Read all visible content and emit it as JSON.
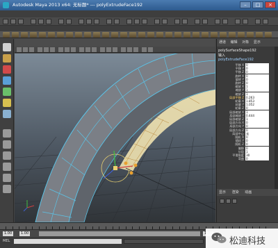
{
  "window": {
    "title": "Autodesk Maya 2013 x64: 无标题* --- polyExtrudeFace192"
  },
  "channel_box": {
    "menu": [
      "通道",
      "编辑",
      "对象",
      "显示"
    ],
    "node_selected": "polySurfaceShape192",
    "inputs_label": "输入",
    "inputs_node": "polyExtrudeFace192",
    "attributes": [
      {
        "label": "平移 X",
        "value": "0"
      },
      {
        "label": "平移 Y",
        "value": "0"
      },
      {
        "label": "平移 Z",
        "value": "0"
      },
      {
        "label": "旋转 X",
        "value": "0"
      },
      {
        "label": "旋转 Y",
        "value": "0"
      },
      {
        "label": "旋转 Z",
        "value": "0"
      },
      {
        "label": "缩放 X",
        "value": "1"
      },
      {
        "label": "缩放 Y",
        "value": "1"
      },
      {
        "label": "缩放 Z",
        "value": "1"
      },
      {
        "label": "局部平移 Z",
        "value": "0.263"
      },
      {
        "label": "轮廓 X",
        "value": "1.853"
      },
      {
        "label": "轮廓 Y",
        "value": "1.052"
      },
      {
        "label": "轮廓 Z",
        "value": "0"
      },
      {
        "label": "局部缩放 X",
        "value": "1"
      },
      {
        "label": "局部缩放 Y",
        "value": "0.444"
      },
      {
        "label": "局部缩放 Z",
        "value": "1"
      },
      {
        "label": "局部方向 X",
        "value": "0"
      },
      {
        "label": "局部方向 Y",
        "value": "0"
      },
      {
        "label": "局部方向 Z",
        "value": "0"
      },
      {
        "label": "局部中心",
        "value": "无"
      },
      {
        "label": "随机 X",
        "value": "0"
      },
      {
        "label": "随机 Y",
        "value": "0"
      },
      {
        "label": "随机 Z",
        "value": "0"
      },
      {
        "label": "偏移",
        "value": "0"
      },
      {
        "label": "分段",
        "value": "1"
      },
      {
        "label": "平滑角度",
        "value": "30"
      },
      {
        "label": "弯曲",
        "value": "0"
      }
    ],
    "highlighted_index": 9,
    "layer_tabs": [
      "显示",
      "渲染",
      "动画"
    ]
  },
  "timeline": {
    "start": "1.00",
    "end": "24.00",
    "range_start": "1.00",
    "range_end": "1.00",
    "current": "1.00"
  },
  "command_line": {
    "label": "MEL"
  },
  "watermark": {
    "text": "松迪科技"
  },
  "colors": {
    "title_bar": "#2d5a8e",
    "wireframe": "#5bc4e8",
    "selected_faces": "#f0e2b0",
    "viewport_top": "#7c8a97",
    "viewport_bottom": "#303438"
  }
}
